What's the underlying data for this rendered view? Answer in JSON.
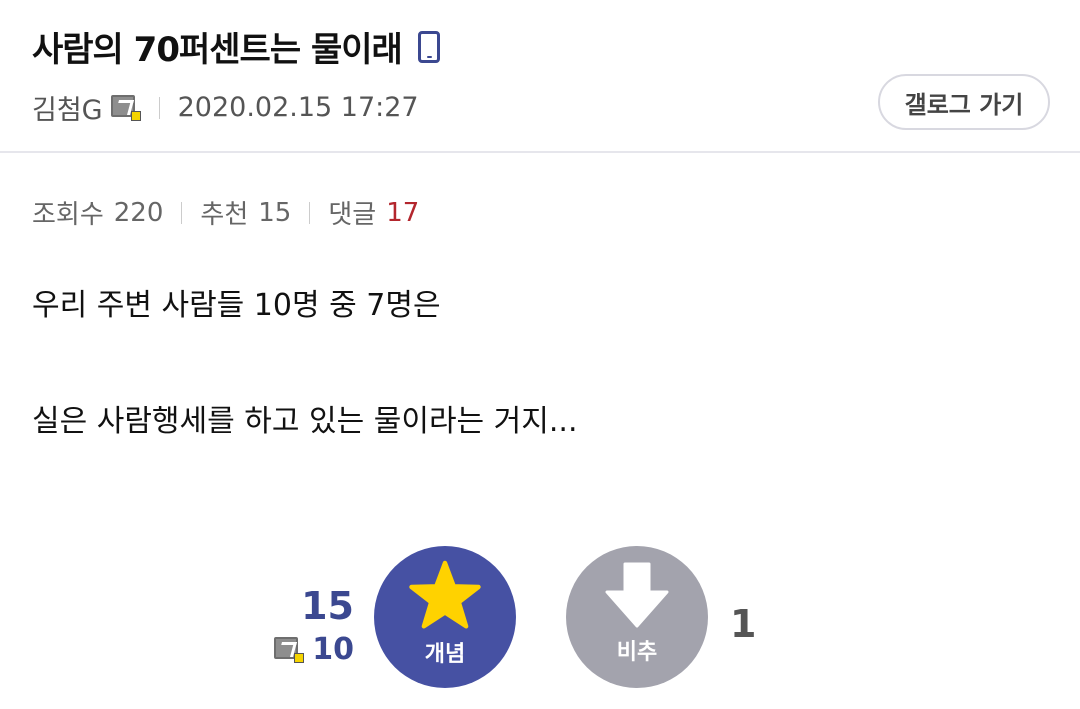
{
  "post": {
    "title": "사람의 70퍼센트는 물이래",
    "author": "김첨G",
    "date": "2020.02.15 17:27",
    "body_line1": "우리 주변 사람들 10명 중 7명은",
    "body_line2": "실은 사람행세를 하고 있는 물이라는 거지..."
  },
  "header": {
    "gallery_button": "갤로그 가기",
    "device_icon": "mobile-phone-icon"
  },
  "stats": {
    "views_label": "조회수",
    "views": "220",
    "recommend_label": "추천",
    "recommend": "15",
    "reply_label": "댓글",
    "reply": "17"
  },
  "vote": {
    "up_count": "15",
    "fix_count": "10",
    "up_label": "개념",
    "down_label": "비추",
    "down_count": "1"
  },
  "colors": {
    "accent": "#4651a3",
    "down": "#a3a3ad",
    "star": "#ffd200",
    "reply": "#b3262d"
  }
}
